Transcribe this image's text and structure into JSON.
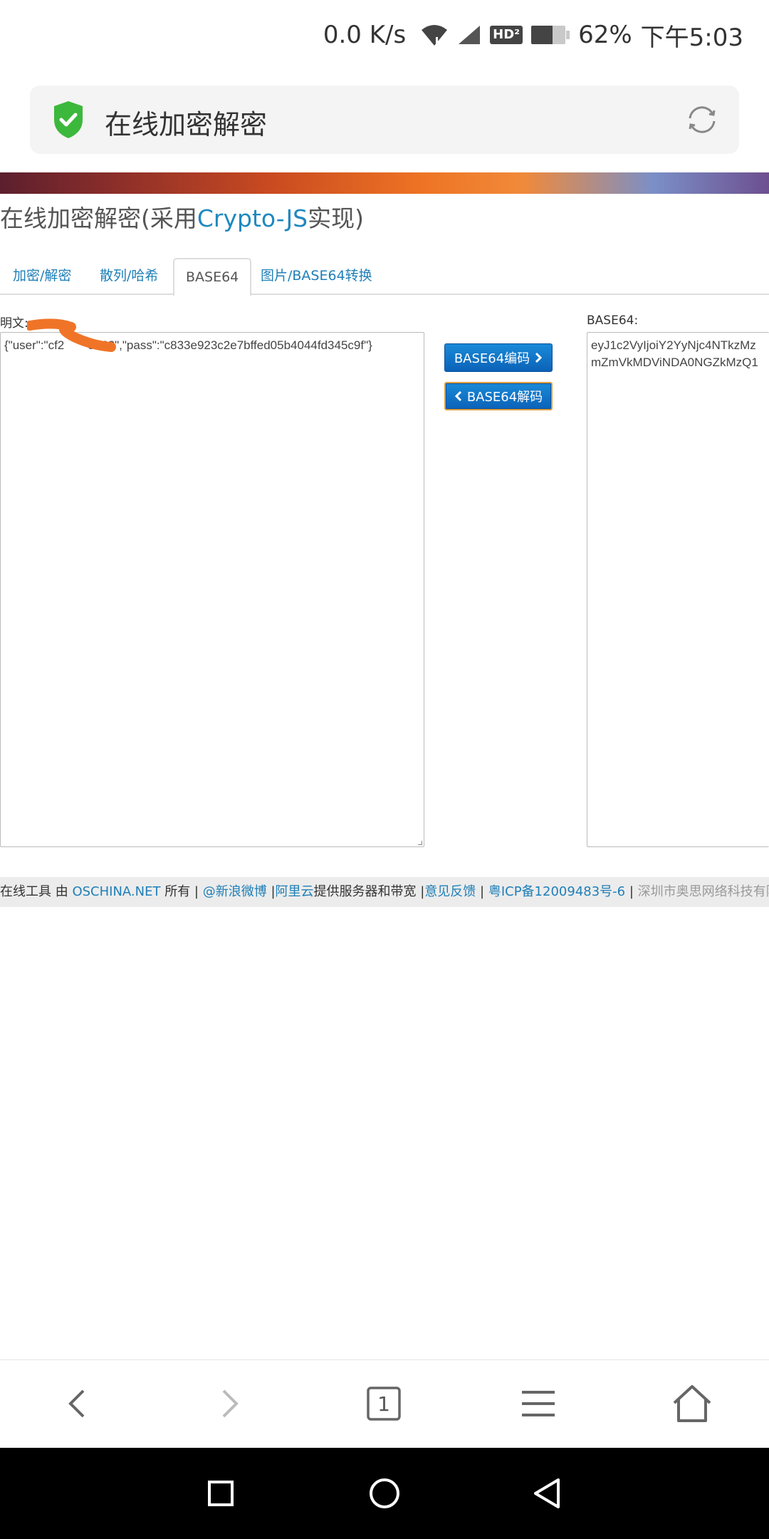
{
  "status_bar": {
    "net_speed": "0.0 K/s",
    "hd_label": "HD²",
    "battery_percent": "62%",
    "battery_level": 0.62,
    "time": "下午5:03"
  },
  "address_bar": {
    "title": "在线加密解密",
    "security_icon": "shield-check-icon",
    "reload_icon": "refresh-icon"
  },
  "page": {
    "title_prefix": "在线加密解密(采用",
    "title_accent": "Crypto-JS",
    "title_suffix": "实现)",
    "tabs": [
      {
        "label": "加密/解密"
      },
      {
        "label": "散列/哈希"
      },
      {
        "label": "BASE64"
      },
      {
        "label": "图片/BASE64转换"
      }
    ],
    "plaintext_label": "明文:",
    "plaintext_value": "{\"user\":\"cf2       3362\",\"pass\":\"c833e923c2e7bffed05b4044fd345c9f\"}",
    "base64_label": "BASE64:",
    "base64_lines": [
      "eyJ1c2VyIjoiY2YyNjc4NTkzMz",
      "mZmVkMDViNDA0NGZkMzQ1"
    ],
    "encode_button": "BASE64编码",
    "decode_button": "BASE64解码"
  },
  "footer": {
    "t1": "在线工具 由 ",
    "l1": "OSCHINA.NET",
    "t2": " 所有 | ",
    "l2": "@新浪微博",
    "t3": " |",
    "l3": "阿里云",
    "t4": "提供服务器和带宽 |",
    "l4": "意见反馈",
    "t5": " | ",
    "l5": "粤ICP备12009483号-6",
    "t6": " | ",
    "m1": "深圳市奥思网络科技有限公司"
  },
  "browser_bar": {
    "tab_count": "1"
  },
  "colors": {
    "link": "#1f7fb8",
    "button": "#0b62b8",
    "scribble": "#f07427",
    "shield": "#3cb83c"
  }
}
